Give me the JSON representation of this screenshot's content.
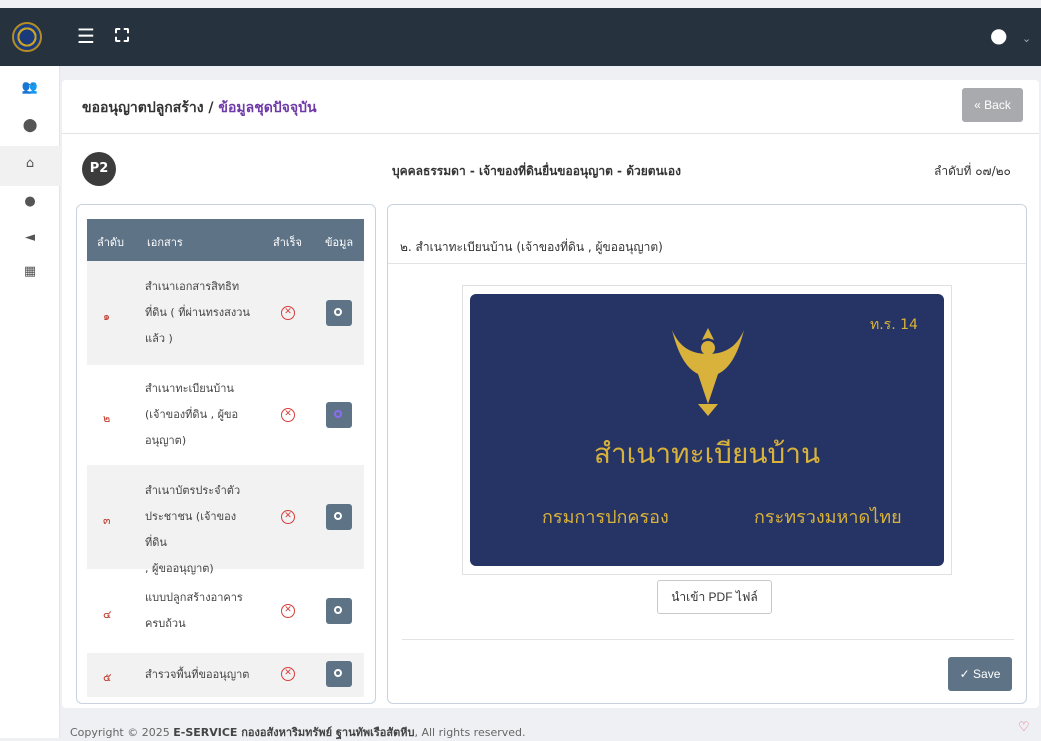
{
  "topbar": {
    "menu_icon": "hamburger-icon",
    "fullscreen_icon": "fullscreen-icon",
    "user_icon": "user-avatar-icon"
  },
  "sidebar": {
    "truncated_label": "..",
    "items": [
      "users-icon",
      "location-icon",
      "home-icon",
      "info-icon",
      "megaphone-icon",
      "calendar-icon"
    ]
  },
  "header": {
    "breadcrumb_main": "ขออนุญาตปลูกสร้าง /",
    "breadcrumb_sub": " ข้อมูลชุดปัจจุบัน",
    "back_label": "« Back"
  },
  "info": {
    "badge": "P2",
    "person_type": "บุคคลธรรมดา - เจ้าของที่ดินยื่นขออนุญาต - ด้วยตนเอง",
    "sequence": "ลำดับที่ ๐๗/๒๐"
  },
  "table": {
    "headers": {
      "order": "ลำดับ",
      "document": "เอกสาร",
      "success": "สำเร็จ",
      "data": "ข้อมูล"
    },
    "rows": [
      {
        "num": "๑",
        "doc_lines": [
          "สำเนาเอกสารสิทธิท",
          "ที่ดิน ( ที่ผ่านทรงสงวน",
          "แล้ว )"
        ],
        "status": "✕"
      },
      {
        "num": "๒",
        "doc_lines": [
          "สำเนาทะเบียนบ้าน",
          "(เจ้าของที่ดิน , ผู้ขอ",
          "อนุญาต)"
        ],
        "status": "✕"
      },
      {
        "num": "๓",
        "doc_lines": [
          "สำเนาบัตรประจำตัว",
          "ประชาชน (เจ้าของที่ดิน",
          ", ผู้ขออนุญาต)"
        ],
        "status": "✕"
      },
      {
        "num": "๔",
        "doc_lines": [
          "แบบปลูกสร้างอาคาร",
          "ครบถ้วน"
        ],
        "status": "✕"
      },
      {
        "num": "๕",
        "doc_lines": [
          "สำรวจพื้นที่ขออนุญาต"
        ],
        "status": "✕"
      }
    ]
  },
  "detail": {
    "title": "๒. สำเนาทะเบียนบ้าน (เจ้าของที่ดิน , ผู้ขออนุญาต)",
    "book": {
      "code": "ท.ร. 14",
      "title": "สำเนาทะเบียนบ้าน",
      "left_text": "กรมการปกครอง",
      "right_text": "กระทรวงมหาดไทย",
      "bg_color": "#253464",
      "text_color": "#d9b23c"
    },
    "import_label": "นำเข้า PDF ไฟล์",
    "save_label": "✓ Save"
  },
  "footer": {
    "prefix": "Copyright © 2025 ",
    "brand": "E-SERVICE กองอสังหาริมทรัพย์ ฐานทัพเรือสัตหีบ",
    "suffix": ", All rights reserved."
  }
}
